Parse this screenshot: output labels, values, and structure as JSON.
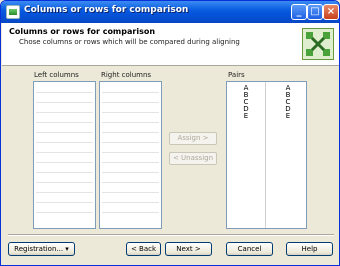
{
  "window": {
    "title": "Columns or rows for comparison",
    "controls": {
      "minimize": "_",
      "maximize": "□",
      "close": "×"
    }
  },
  "header": {
    "title": "Columns or rows for comparison",
    "subtitle": "Chose columns or rows which will be compared during aligning"
  },
  "left_list": {
    "label": "Left columns"
  },
  "right_list": {
    "label": "Right columns"
  },
  "pairs": {
    "label": "Pairs",
    "left": [
      "A",
      "B",
      "C",
      "D",
      "E"
    ],
    "right": [
      "A",
      "B",
      "C",
      "D",
      "E"
    ]
  },
  "buttons": {
    "assign": "Assign >",
    "unassign": "< Unassign",
    "registration": "Registration...",
    "back": "< Back",
    "next": "Next >",
    "cancel": "Cancel",
    "help": "Help"
  }
}
